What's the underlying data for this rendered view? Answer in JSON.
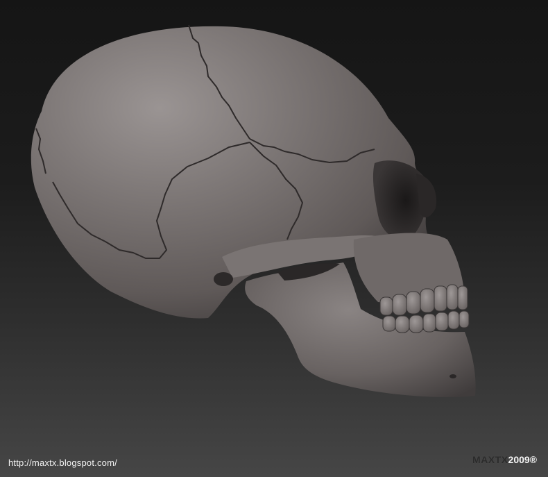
{
  "scene": {
    "subject": "skull-render",
    "colors": {
      "background_top": "#151515",
      "background_bottom": "#464646",
      "bone_light": "#8e8887",
      "bone_mid": "#6d6766",
      "bone_dark": "#3e3a3a",
      "suture": "#2e2a2a"
    }
  },
  "footer": {
    "url": "http://maxtx.blogspot.com/",
    "signature_brand": "MAXTX",
    "signature_year": "2009®"
  }
}
